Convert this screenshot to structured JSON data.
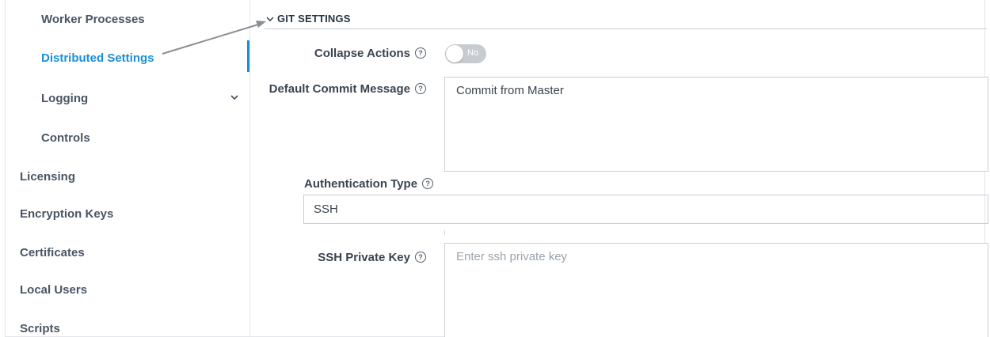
{
  "sidebar": {
    "items": [
      {
        "label": "Worker Processes"
      },
      {
        "label": "Distributed Settings",
        "active": true
      },
      {
        "label": "Logging",
        "expandable": true
      },
      {
        "label": "Controls"
      },
      {
        "label": "Licensing"
      },
      {
        "label": "Encryption Keys"
      },
      {
        "label": "Certificates"
      },
      {
        "label": "Local Users"
      },
      {
        "label": "Scripts"
      }
    ],
    "active_color": "#1a8fd6"
  },
  "main": {
    "section_title": "GIT SETTINGS",
    "collapse_actions": {
      "label": "Collapse Actions",
      "toggle_text": "No",
      "value": false
    },
    "default_commit_message": {
      "label": "Default Commit Message",
      "value": "Commit from Master"
    },
    "authentication_type": {
      "label": "Authentication Type",
      "value": "SSH"
    },
    "ssh_private_key": {
      "label": "SSH Private Key",
      "placeholder": "Enter ssh private key"
    }
  },
  "icons": {
    "help": "help-circle-icon",
    "section_toggle": "chevron-down-icon",
    "logging_expand": "chevron-down-icon"
  }
}
